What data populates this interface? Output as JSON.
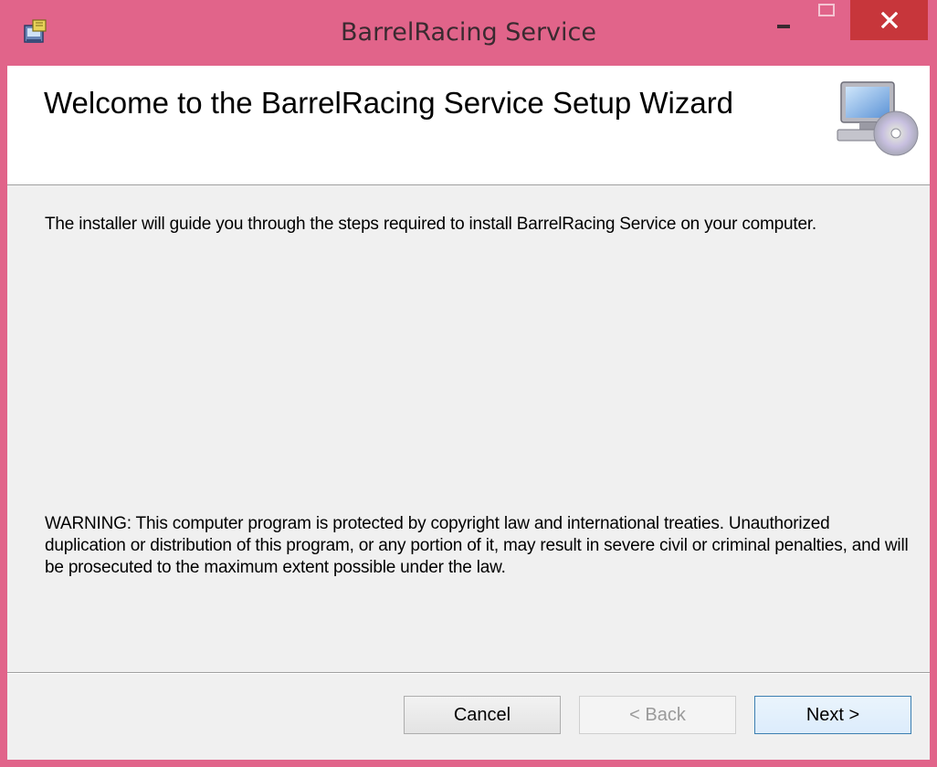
{
  "window": {
    "title": "BarrelRacing Service",
    "app_icon": "installer-icon",
    "controls": {
      "minimize": "minimize-icon",
      "maximize": "maximize-icon",
      "close": "close-icon"
    },
    "colors": {
      "frame": "#e1648a",
      "close_button": "#c7363b",
      "client_background": "#f0f0f0"
    }
  },
  "banner": {
    "title": "Welcome to the BarrelRacing Service Setup Wizard",
    "icon": "computer-cd-icon"
  },
  "content": {
    "intro": "The installer will guide you through the steps required to install BarrelRacing Service on your computer.",
    "warning": "WARNING: This computer program is protected by copyright law and international treaties. Unauthorized duplication or distribution of this program, or any portion of it, may result in severe civil or criminal penalties, and will be prosecuted to the maximum extent possible under the law."
  },
  "buttons": {
    "cancel": "Cancel",
    "back": "< Back",
    "next": "Next >",
    "back_enabled": false
  }
}
